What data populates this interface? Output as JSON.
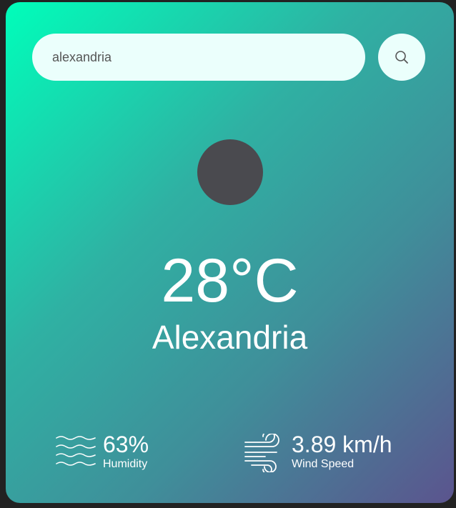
{
  "search": {
    "value": "alexandria"
  },
  "weather": {
    "temperature": "28°C",
    "city": "Alexandria"
  },
  "details": {
    "humidity": {
      "value": "63%",
      "label": "Humidity",
      "icon": "waves-icon"
    },
    "wind": {
      "value": "3.89 km/h",
      "label": "Wind Speed",
      "icon": "wind-icon"
    }
  },
  "icons": {
    "search": "search-icon",
    "weather": "weather-icon"
  },
  "colors": {
    "background": "#222222",
    "gradient_start": "#00feba",
    "gradient_end": "#5b548e",
    "search_background": "#ebfffc",
    "weather_icon": "#4a4a4f",
    "text": "#ffffff"
  }
}
